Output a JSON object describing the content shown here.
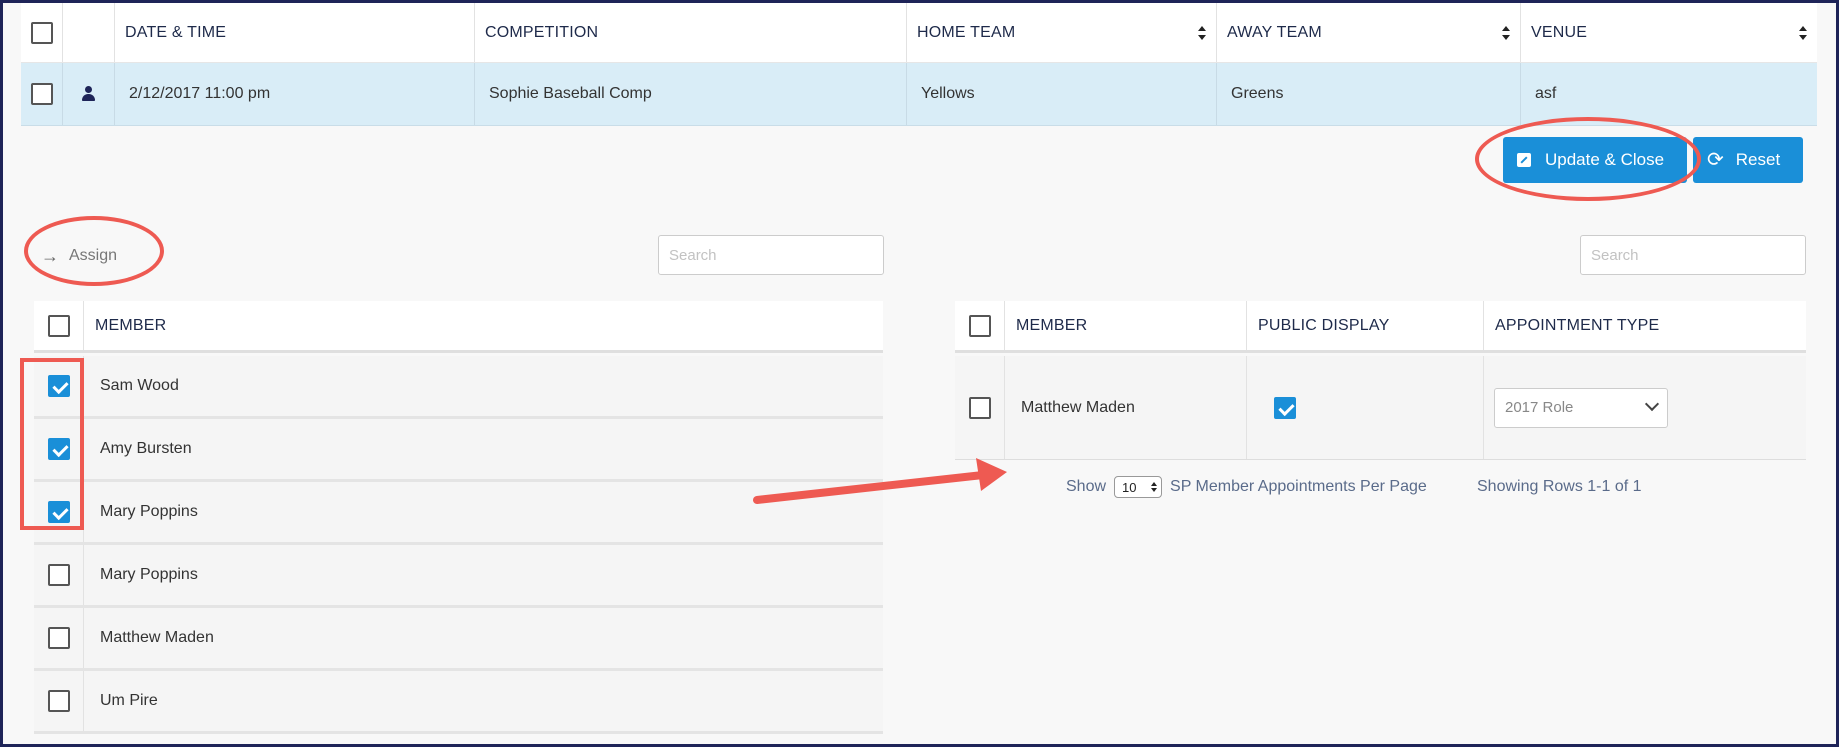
{
  "events_table": {
    "headers": {
      "date_time": "DATE & TIME",
      "competition": "COMPETITION",
      "home_team": "HOME TEAM",
      "away_team": "AWAY TEAM",
      "venue": "VENUE"
    },
    "row": {
      "date_time": "2/12/2017 11:00 pm",
      "competition": "Sophie Baseball Comp",
      "home_team": "Yellows",
      "away_team": "Greens",
      "venue": "asf"
    }
  },
  "actions": {
    "update_close_label": "Update & Close",
    "reset_label": "Reset",
    "assign_label": "Assign"
  },
  "left_panel": {
    "search_placeholder": "Search",
    "header_member": "MEMBER",
    "members": [
      {
        "name": "Sam Wood",
        "checked": true
      },
      {
        "name": "Amy Bursten",
        "checked": true
      },
      {
        "name": "Mary Poppins",
        "checked": true
      },
      {
        "name": "Mary Poppins",
        "checked": false
      },
      {
        "name": "Matthew Maden",
        "checked": false
      },
      {
        "name": "Um Pire",
        "checked": false
      }
    ]
  },
  "right_panel": {
    "search_placeholder": "Search",
    "headers": {
      "member": "MEMBER",
      "public_display": "PUBLIC DISPLAY",
      "appointment_type": "APPOINTMENT TYPE"
    },
    "rows": [
      {
        "member": "Matthew Maden",
        "public_display": true,
        "appointment_type": "2017 Role"
      }
    ],
    "pager": {
      "show_label": "Show",
      "per_page_value": "10",
      "per_page_suffix": "SP Member Appointments Per Page",
      "showing_rows": "Showing Rows 1-1 of 1"
    }
  },
  "colors": {
    "primary": "#1a8fd8",
    "selected_row": "#d9edf7",
    "annotation": "#ee5a52",
    "frame": "#1e2458"
  }
}
